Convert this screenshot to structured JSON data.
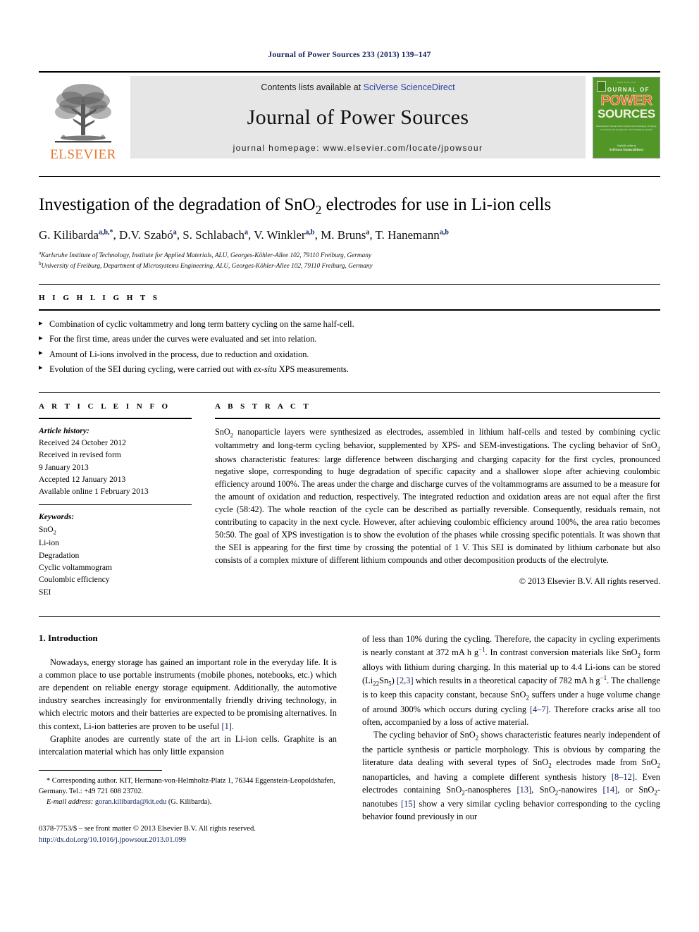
{
  "running_head": "Journal of Power Sources 233 (2013) 139–147",
  "masthead": {
    "publisher_name": "ELSEVIER",
    "publisher_logo_icon": "elsevier-tree-icon",
    "contents_prefix": "Contents lists available at",
    "contents_link": "SciVerse ScienceDirect",
    "journal_name": "Journal of Power Sources",
    "homepage_label": "journal homepage: www.elsevier.com/locate/jpowsour",
    "cover": {
      "issn_top": "ISSN 0378-7753",
      "line1": "JOURNAL OF",
      "line2": "POWER",
      "line3": "SOURCES",
      "subtitle": "International Journal on the Science and Technology of Energy Conversion and Storage incl. Electrochemical Systems",
      "imprint_label": "Available online at",
      "imprint": "SciVerse ScienceDirect"
    }
  },
  "article": {
    "title_parts": [
      "Investigation of the degradation of SnO",
      "2",
      " electrodes for use in Li-ion cells"
    ],
    "authors": [
      {
        "name": "G. Kilibarda",
        "sup": "a,b,*"
      },
      {
        "name": "D.V. Szabó",
        "sup": "a"
      },
      {
        "name": "S. Schlabach",
        "sup": "a"
      },
      {
        "name": "V. Winkler",
        "sup": "a,b"
      },
      {
        "name": "M. Bruns",
        "sup": "a"
      },
      {
        "name": "T. Hanemann",
        "sup": "a,b"
      }
    ],
    "affiliations": [
      {
        "marker": "a",
        "text": "Karlsruhe Institute of Technology, Institute for Applied Materials, ALU, Georges-Köhler-Allee 102, 79110 Freiburg, Germany"
      },
      {
        "marker": "b",
        "text": "University of Freiburg, Department of Microsystems Engineering, ALU, Georges-Köhler-Allee 102, 79110 Freiburg, Germany"
      }
    ]
  },
  "highlights": {
    "heading": "H I G H L I G H T S",
    "items": [
      "Combination of cyclic voltammetry and long term battery cycling on the same half-cell.",
      "For the first time, areas under the curves were evaluated and set into relation.",
      "Amount of Li-ions involved in the process, due to reduction and oxidation.",
      "Evolution of the SEI during cycling, were carried out with ex-situ XPS measurements."
    ]
  },
  "article_info": {
    "heading": "A R T I C L E  I N F O",
    "history_label": "Article history:",
    "history": [
      "Received 24 October 2012",
      "Received in revised form",
      "9 January 2013",
      "Accepted 12 January 2013",
      "Available online 1 February 2013"
    ],
    "keywords_label": "Keywords:",
    "keywords": [
      "SnO2",
      "Li-ion",
      "Degradation",
      "Cyclic voltammogram",
      "Coulombic efficiency",
      "SEI"
    ]
  },
  "abstract": {
    "heading": "A B S T R A C T",
    "text": "SnO2 nanoparticle layers were synthesized as electrodes, assembled in lithium half-cells and tested by combining cyclic voltammetry and long-term cycling behavior, supplemented by XPS- and SEM-investigations. The cycling behavior of SnO2 shows characteristic features: large difference between discharging and charging capacity for the first cycles, pronounced negative slope, corresponding to huge degradation of specific capacity and a shallower slope after achieving coulombic efficiency around 100%. The areas under the charge and discharge curves of the voltammograms are assumed to be a measure for the amount of oxidation and reduction, respectively. The integrated reduction and oxidation areas are not equal after the first cycle (58:42). The whole reaction of the cycle can be described as partially reversible. Consequently, residuals remain, not contributing to capacity in the next cycle. However, after achieving coulombic efficiency around 100%, the area ratio becomes 50:50. The goal of XPS investigation is to show the evolution of the phases while crossing specific potentials. It was shown that the SEI is appearing for the first time by crossing the potential of 1 V. This SEI is dominated by lithium carbonate but also consists of a complex mixture of different lithium compounds and other decomposition products of the electrolyte.",
    "copyright": "© 2013 Elsevier B.V. All rights reserved."
  },
  "body": {
    "section_number": "1.",
    "section_title": "Introduction",
    "left_paragraphs": [
      "Nowadays, energy storage has gained an important role in the everyday life. It is a common place to use portable instruments (mobile phones, notebooks, etc.) which are dependent on reliable energy storage equipment. Additionally, the automotive industry searches increasingly for environmentally friendly driving technology, in which electric motors and their batteries are expected to be promising alternatives. In this context, Li-ion batteries are proven to be useful [1].",
      "Graphite anodes are currently state of the art in Li-ion cells. Graphite is an intercalation material which has only little expansion"
    ],
    "right_paragraphs": [
      "of less than 10% during the cycling. Therefore, the capacity in cycling experiments is nearly constant at 372 mA h g−1. In contrast conversion materials like SnO2 form alloys with lithium during charging. In this material up to 4.4 Li-ions can be stored (Li22Sn5) [2,3] which results in a theoretical capacity of 782 mA h g−1. The challenge is to keep this capacity constant, because SnO2 suffers under a huge volume change of around 300% which occurs during cycling [4–7]. Therefore cracks arise all too often, accompanied by a loss of active material.",
      "The cycling behavior of SnO2 shows characteristic features nearly independent of the particle synthesis or particle morphology. This is obvious by comparing the literature data dealing with several types of SnO2 electrodes made from SnO2 nanoparticles, and having a complete different synthesis history [8–12]. Even electrodes containing SnO2-nanospheres [13], SnO2-nanowires [14], or SnO2-nanotubes [15] show a very similar cycling behavior corresponding to the cycling behavior found previously in our"
    ]
  },
  "footnotes": {
    "corresponding": "* Corresponding author. KIT, Hermann-von-Helmholtz-Platz 1, 76344 Eggenstein-Leopoldshafen, Germany. Tel.: +49 721 608 23702.",
    "email_label": "E-mail address:",
    "email": "goran.kilibarda@kit.edu",
    "email_suffix": "(G. Kilibarda)."
  },
  "issn_block": {
    "line1": "0378-7753/$ – see front matter © 2013 Elsevier B.V. All rights reserved.",
    "doi": "http://dx.doi.org/10.1016/j.jpowsour.2013.01.099"
  },
  "colors": {
    "link": "#12215c",
    "sciencedirect": "#2b3fa0",
    "elsevier_orange": "#e8732a",
    "cover_green": "#519627",
    "band_gray": "#e6e6e6"
  }
}
